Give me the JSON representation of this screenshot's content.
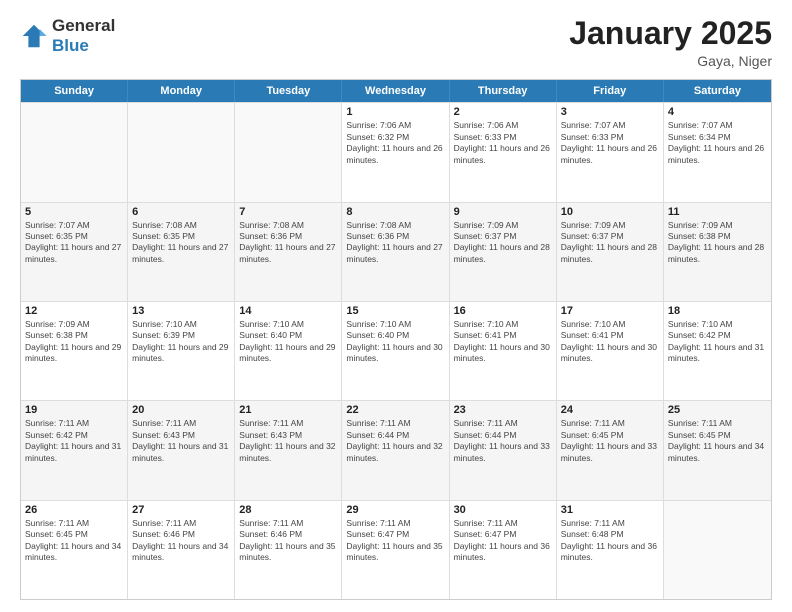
{
  "header": {
    "logo": {
      "general": "General",
      "blue": "Blue"
    },
    "title": "January 2025",
    "location": "Gaya, Niger"
  },
  "weekdays": [
    "Sunday",
    "Monday",
    "Tuesday",
    "Wednesday",
    "Thursday",
    "Friday",
    "Saturday"
  ],
  "rows": [
    [
      {
        "day": "",
        "sunrise": "",
        "sunset": "",
        "daylight": ""
      },
      {
        "day": "",
        "sunrise": "",
        "sunset": "",
        "daylight": ""
      },
      {
        "day": "",
        "sunrise": "",
        "sunset": "",
        "daylight": ""
      },
      {
        "day": "1",
        "sunrise": "Sunrise: 7:06 AM",
        "sunset": "Sunset: 6:32 PM",
        "daylight": "Daylight: 11 hours and 26 minutes."
      },
      {
        "day": "2",
        "sunrise": "Sunrise: 7:06 AM",
        "sunset": "Sunset: 6:33 PM",
        "daylight": "Daylight: 11 hours and 26 minutes."
      },
      {
        "day": "3",
        "sunrise": "Sunrise: 7:07 AM",
        "sunset": "Sunset: 6:33 PM",
        "daylight": "Daylight: 11 hours and 26 minutes."
      },
      {
        "day": "4",
        "sunrise": "Sunrise: 7:07 AM",
        "sunset": "Sunset: 6:34 PM",
        "daylight": "Daylight: 11 hours and 26 minutes."
      }
    ],
    [
      {
        "day": "5",
        "sunrise": "Sunrise: 7:07 AM",
        "sunset": "Sunset: 6:35 PM",
        "daylight": "Daylight: 11 hours and 27 minutes."
      },
      {
        "day": "6",
        "sunrise": "Sunrise: 7:08 AM",
        "sunset": "Sunset: 6:35 PM",
        "daylight": "Daylight: 11 hours and 27 minutes."
      },
      {
        "day": "7",
        "sunrise": "Sunrise: 7:08 AM",
        "sunset": "Sunset: 6:36 PM",
        "daylight": "Daylight: 11 hours and 27 minutes."
      },
      {
        "day": "8",
        "sunrise": "Sunrise: 7:08 AM",
        "sunset": "Sunset: 6:36 PM",
        "daylight": "Daylight: 11 hours and 27 minutes."
      },
      {
        "day": "9",
        "sunrise": "Sunrise: 7:09 AM",
        "sunset": "Sunset: 6:37 PM",
        "daylight": "Daylight: 11 hours and 28 minutes."
      },
      {
        "day": "10",
        "sunrise": "Sunrise: 7:09 AM",
        "sunset": "Sunset: 6:37 PM",
        "daylight": "Daylight: 11 hours and 28 minutes."
      },
      {
        "day": "11",
        "sunrise": "Sunrise: 7:09 AM",
        "sunset": "Sunset: 6:38 PM",
        "daylight": "Daylight: 11 hours and 28 minutes."
      }
    ],
    [
      {
        "day": "12",
        "sunrise": "Sunrise: 7:09 AM",
        "sunset": "Sunset: 6:38 PM",
        "daylight": "Daylight: 11 hours and 29 minutes."
      },
      {
        "day": "13",
        "sunrise": "Sunrise: 7:10 AM",
        "sunset": "Sunset: 6:39 PM",
        "daylight": "Daylight: 11 hours and 29 minutes."
      },
      {
        "day": "14",
        "sunrise": "Sunrise: 7:10 AM",
        "sunset": "Sunset: 6:40 PM",
        "daylight": "Daylight: 11 hours and 29 minutes."
      },
      {
        "day": "15",
        "sunrise": "Sunrise: 7:10 AM",
        "sunset": "Sunset: 6:40 PM",
        "daylight": "Daylight: 11 hours and 30 minutes."
      },
      {
        "day": "16",
        "sunrise": "Sunrise: 7:10 AM",
        "sunset": "Sunset: 6:41 PM",
        "daylight": "Daylight: 11 hours and 30 minutes."
      },
      {
        "day": "17",
        "sunrise": "Sunrise: 7:10 AM",
        "sunset": "Sunset: 6:41 PM",
        "daylight": "Daylight: 11 hours and 30 minutes."
      },
      {
        "day": "18",
        "sunrise": "Sunrise: 7:10 AM",
        "sunset": "Sunset: 6:42 PM",
        "daylight": "Daylight: 11 hours and 31 minutes."
      }
    ],
    [
      {
        "day": "19",
        "sunrise": "Sunrise: 7:11 AM",
        "sunset": "Sunset: 6:42 PM",
        "daylight": "Daylight: 11 hours and 31 minutes."
      },
      {
        "day": "20",
        "sunrise": "Sunrise: 7:11 AM",
        "sunset": "Sunset: 6:43 PM",
        "daylight": "Daylight: 11 hours and 31 minutes."
      },
      {
        "day": "21",
        "sunrise": "Sunrise: 7:11 AM",
        "sunset": "Sunset: 6:43 PM",
        "daylight": "Daylight: 11 hours and 32 minutes."
      },
      {
        "day": "22",
        "sunrise": "Sunrise: 7:11 AM",
        "sunset": "Sunset: 6:44 PM",
        "daylight": "Daylight: 11 hours and 32 minutes."
      },
      {
        "day": "23",
        "sunrise": "Sunrise: 7:11 AM",
        "sunset": "Sunset: 6:44 PM",
        "daylight": "Daylight: 11 hours and 33 minutes."
      },
      {
        "day": "24",
        "sunrise": "Sunrise: 7:11 AM",
        "sunset": "Sunset: 6:45 PM",
        "daylight": "Daylight: 11 hours and 33 minutes."
      },
      {
        "day": "25",
        "sunrise": "Sunrise: 7:11 AM",
        "sunset": "Sunset: 6:45 PM",
        "daylight": "Daylight: 11 hours and 34 minutes."
      }
    ],
    [
      {
        "day": "26",
        "sunrise": "Sunrise: 7:11 AM",
        "sunset": "Sunset: 6:45 PM",
        "daylight": "Daylight: 11 hours and 34 minutes."
      },
      {
        "day": "27",
        "sunrise": "Sunrise: 7:11 AM",
        "sunset": "Sunset: 6:46 PM",
        "daylight": "Daylight: 11 hours and 34 minutes."
      },
      {
        "day": "28",
        "sunrise": "Sunrise: 7:11 AM",
        "sunset": "Sunset: 6:46 PM",
        "daylight": "Daylight: 11 hours and 35 minutes."
      },
      {
        "day": "29",
        "sunrise": "Sunrise: 7:11 AM",
        "sunset": "Sunset: 6:47 PM",
        "daylight": "Daylight: 11 hours and 35 minutes."
      },
      {
        "day": "30",
        "sunrise": "Sunrise: 7:11 AM",
        "sunset": "Sunset: 6:47 PM",
        "daylight": "Daylight: 11 hours and 36 minutes."
      },
      {
        "day": "31",
        "sunrise": "Sunrise: 7:11 AM",
        "sunset": "Sunset: 6:48 PM",
        "daylight": "Daylight: 11 hours and 36 minutes."
      },
      {
        "day": "",
        "sunrise": "",
        "sunset": "",
        "daylight": ""
      }
    ]
  ]
}
